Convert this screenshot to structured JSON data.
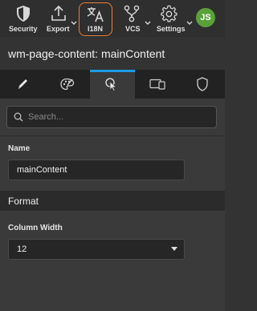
{
  "toolbar": {
    "items": [
      {
        "label": "Security",
        "icon": "shield-icon"
      },
      {
        "label": "Export",
        "icon": "export-icon"
      },
      {
        "label": "I18N",
        "icon": "translate-icon"
      },
      {
        "label": "VCS",
        "icon": "branch-icon"
      },
      {
        "label": "Settings",
        "icon": "gear-icon"
      }
    ],
    "avatar_initials": "JS",
    "highlight_color": "#e87d3e",
    "avatar_color": "#5aa13a"
  },
  "panel_title": "wm-page-content: mainContent",
  "tabs": [
    {
      "icon": "pencil-icon",
      "active": false
    },
    {
      "icon": "palette-icon",
      "active": false
    },
    {
      "icon": "cursor-select-icon",
      "active": true
    },
    {
      "icon": "devices-icon",
      "active": false
    },
    {
      "icon": "shield-outline-icon",
      "active": false
    }
  ],
  "accent_color": "#1b9ce6",
  "search": {
    "placeholder": "Search..."
  },
  "properties": {
    "name_label": "Name",
    "name_value": "mainContent",
    "format_heading": "Format",
    "column_width_label": "Column Width",
    "column_width_value": "12"
  }
}
